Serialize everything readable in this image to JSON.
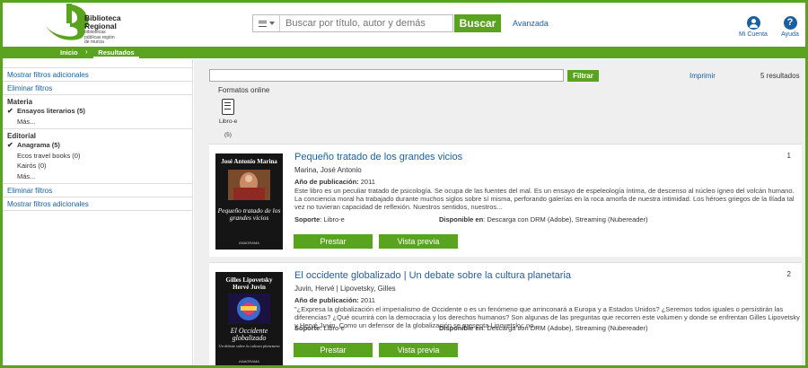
{
  "header": {
    "logo_title": "Biblioteca\nRegional",
    "logo_subtitle": "bibliotecas públicas región de murcia",
    "search_placeholder": "Buscar por título, autor y demás",
    "search_button": "Buscar",
    "advanced_link": "Avanzada",
    "account_label": "Mi Cuenta",
    "help_label": "Ayuda",
    "help_glyph": "?"
  },
  "nav": {
    "home": "Inicio",
    "separator": "›",
    "results": "Resultados"
  },
  "sidebar": {
    "show_more_filters": "Mostrar filtros adicionales",
    "remove_filters": "Eliminar filtros",
    "materia": {
      "heading": "Materia",
      "items": [
        {
          "label": "Ensayos literarios (5)",
          "checked": true
        }
      ],
      "more": "Más..."
    },
    "editorial": {
      "heading": "Editorial",
      "items": [
        {
          "label": "Anagrama (5)",
          "checked": true
        },
        {
          "label": "Ecos travel books (0)",
          "checked": false
        },
        {
          "label": "Kairós (0)",
          "checked": false
        }
      ],
      "more": "Más..."
    },
    "remove_filters_bottom": "Eliminar filtros",
    "show_more_filters_bottom": "Mostrar filtros adicionales"
  },
  "main": {
    "filter_button": "Filtrar",
    "print_link": "Imprimir",
    "results_count": "5 resultados",
    "formats_label": "Formatos online",
    "format_ebook_label": "Libro-e",
    "format_ebook_count": "(5)"
  },
  "results": [
    {
      "rank": "1",
      "title": "Pequeño tratado de los grandes vicios",
      "author": "Marina, José Antonio",
      "year_label": "Año de publicación:",
      "year": "2011",
      "description": "Este libro es un peculiar tratado de psicología. Se ocupa de las fuentes del mal. Es un ensayo de espeleología íntima, de descenso al núcleo ígneo del volcán humano. La conciencia moral ha trabajado durante muchos siglos sobre sí misma, perforando galerías en la roca amorfa de nuestra intimidad. Los héroes griegos de la Ilíada tal vez no tuvieran capacidad de reflexión. Nuestros sentidos, nuestros...",
      "support_label": "Soporte",
      "support": ": Libro-e",
      "availability_label": "Disponible en",
      "availability": ": Descarga con DRM (Adobe), Streaming (Nubereader)",
      "btn_borrow": "Prestar",
      "btn_preview": "Vista previa",
      "cover_author": "José Antonio Marina",
      "cover_title": "Pequeño tratado de los grandes vicios",
      "cover_publisher": "ANAGRAMA"
    },
    {
      "rank": "2",
      "title": "El occidente globalizado | Un debate sobre la cultura planetaria",
      "author": "Juvin, Hervé | Lipovetsky, Gilles",
      "year_label": "Año de publicación:",
      "year": "2011",
      "description": "\"¿Expresa la globalización el imperialismo de Occidente o es un fenómeno que arrinconará a Europa y a Estados Unidos? ¿Seremos todos iguales o persistirán las diferencias? ¿Qué ocurrirá con la democracia y los derechos humanos? Son algunas de las preguntas que recorren este volumen y donde se enfrentan Gilles Lipovetsky y Hervé Juvin. Como un defensor de la globalización se presenta Lipovetsky; no...",
      "support_label": "Soporte",
      "support": ": Libro-e",
      "availability_label": "Disponible en",
      "availability": ": Descarga con DRM (Adobe), Streaming (Nubereader)",
      "btn_borrow": "Prestar",
      "btn_preview": "Vista previa",
      "cover_author": "Gilles Lipovetsky\nHervé Juvin",
      "cover_title": "El Occidente globalizado",
      "cover_subtitle": "Un debate sobre la cultura planetaria",
      "cover_publisher": "ANAGRAMA"
    }
  ],
  "colors": {
    "brand_green": "#5aa31f",
    "link_blue": "#1a5fa0"
  }
}
